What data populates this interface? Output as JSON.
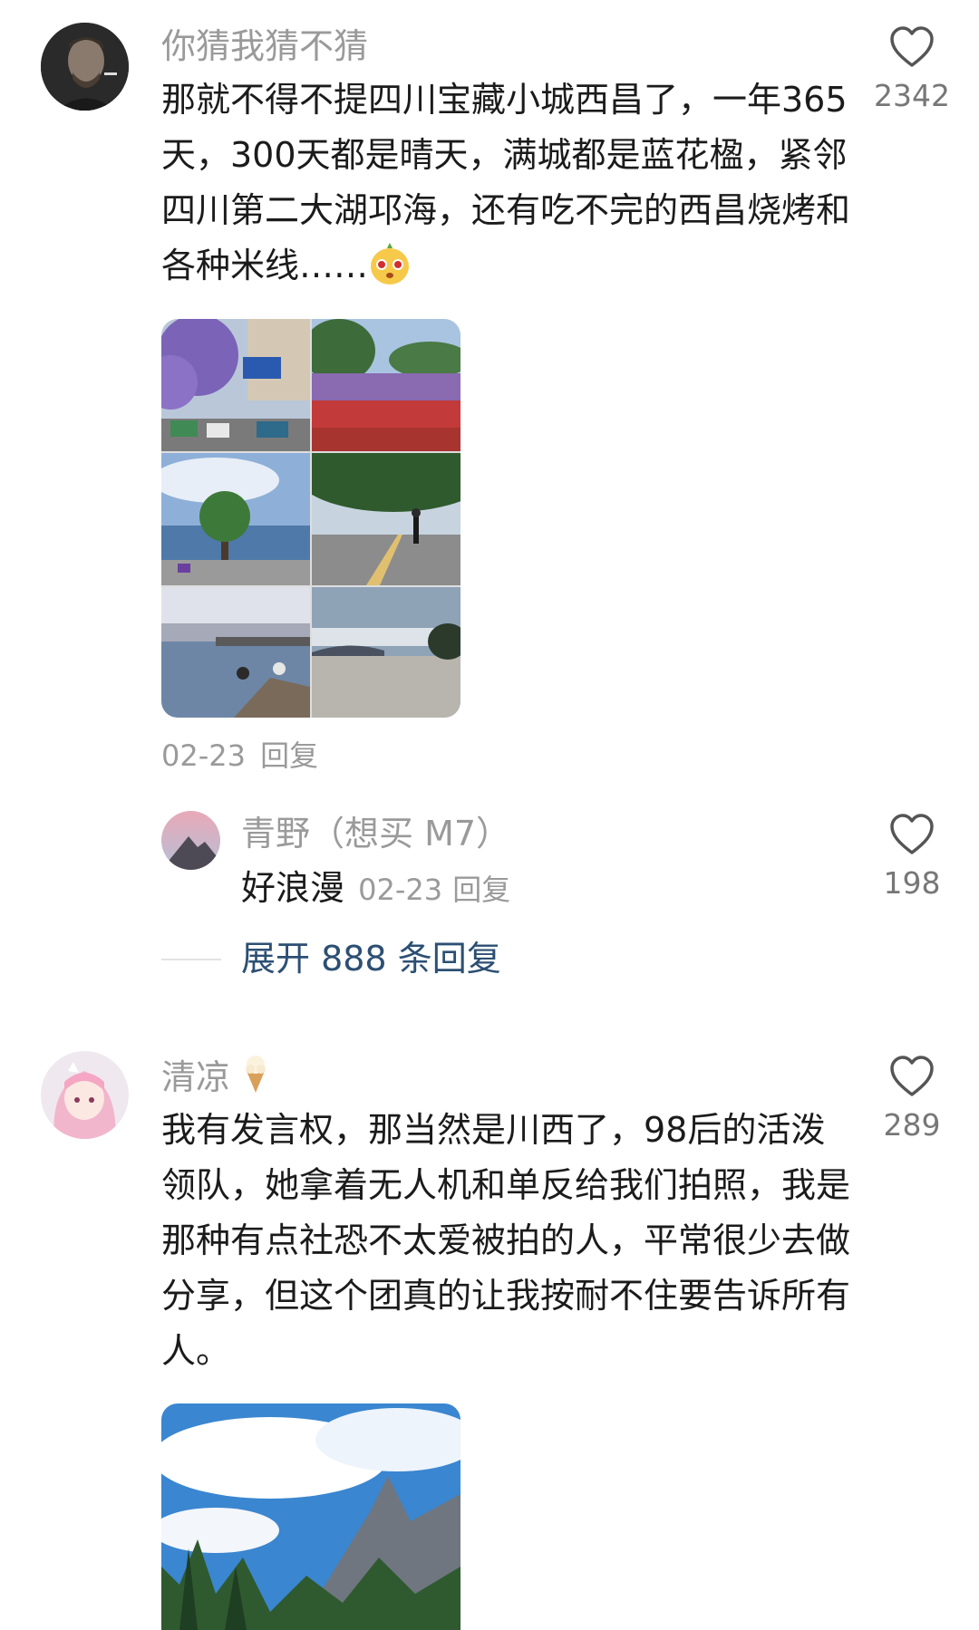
{
  "comments": [
    {
      "username": "你猜我猜不猜",
      "text": "那就不得不提四川宝藏小城西昌了，一年365天，300天都是晴天，满城都是蓝花楹，紧邻四川第二大湖邛海，还有吃不完的西昌烧烤和各种米线……",
      "emoji": "mango-face-emoji",
      "date": "02-23",
      "reply_label": "回复",
      "likes": "2342",
      "image_grid": [
        "jacaranda-street-photo",
        "flower-field-photo",
        "lake-tree-photo",
        "lakeside-path-photo",
        "lake-dock-photo",
        "beach-sunset-photo"
      ],
      "replies": [
        {
          "username": "青野（想买 M7）",
          "text": "好浪漫",
          "date": "02-23",
          "reply_label": "回复",
          "likes": "198"
        }
      ],
      "expand_label": "展开 888 条回复"
    },
    {
      "username": "清凉",
      "username_emoji": "ice-cream-icon",
      "text": "我有发言权，那当然是川西了，98后的活泼领队，她拿着无人机和单反给我们拍照，我是那种有点社恐不太爱被拍的人，平常很少去做分享，但这个团真的让我按耐不住要告诉所有人。",
      "likes": "289",
      "image": "mountain-forest-photo"
    }
  ],
  "colors": {
    "username": "#9a9a9a",
    "text": "#1b1b1b",
    "link": "#2c4f73"
  }
}
